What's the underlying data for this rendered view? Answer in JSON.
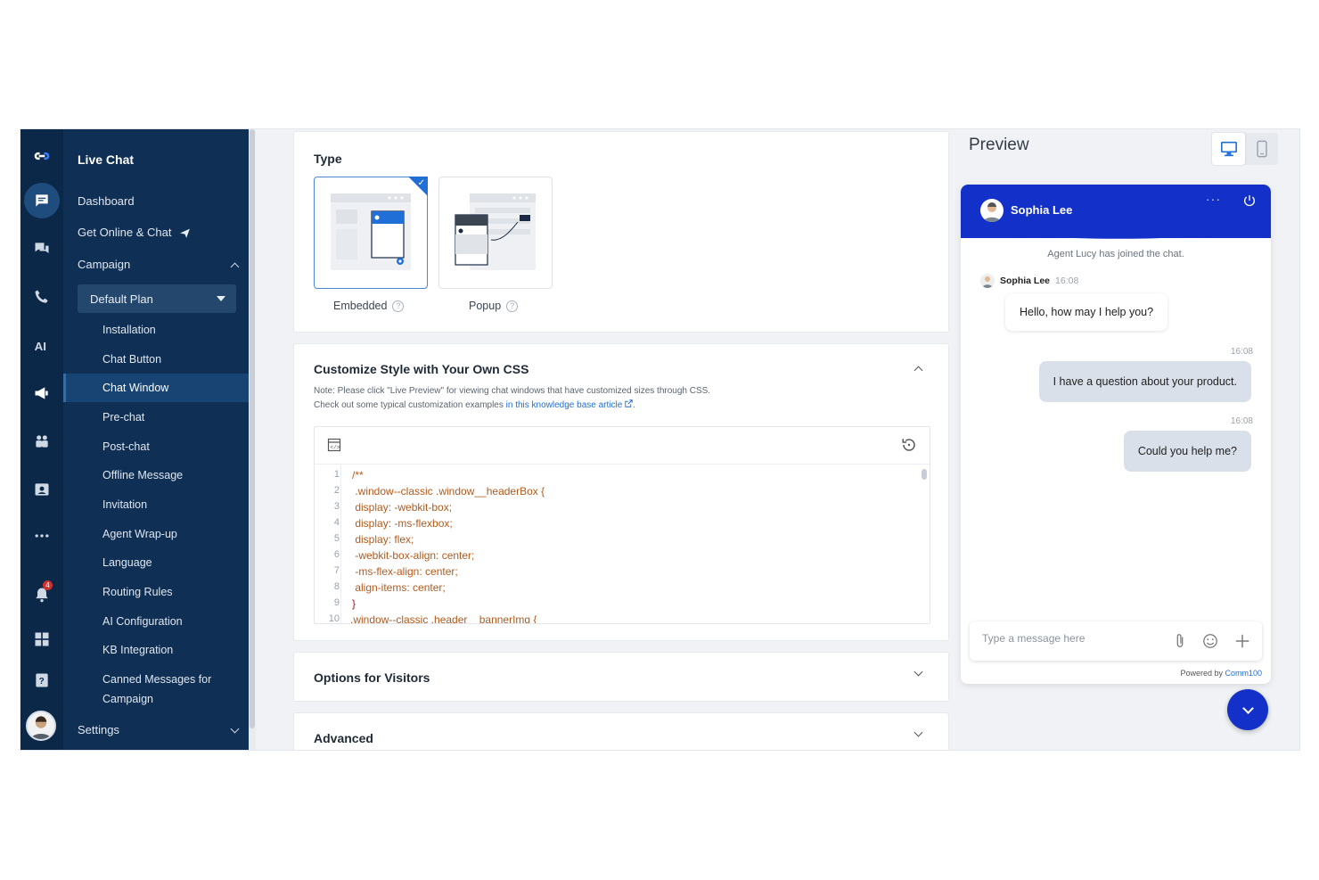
{
  "nav": {
    "title": "Live Chat",
    "items": {
      "dashboard": "Dashboard",
      "get_online": "Get Online & Chat",
      "campaign": "Campaign",
      "settings": "Settings"
    },
    "plan_select": "Default Plan",
    "sub_items": [
      "Installation",
      "Chat Button",
      "Chat Window",
      "Pre-chat",
      "Post-chat",
      "Offline Message",
      "Invitation",
      "Agent Wrap-up",
      "Language",
      "Routing Rules",
      "AI Configuration",
      "KB Integration",
      "Canned Messages for",
      "Campaign"
    ],
    "active_sub": "Chat Window",
    "notification_count": "4"
  },
  "type_section": {
    "title": "Type",
    "options": [
      {
        "label": "Embedded",
        "selected": true
      },
      {
        "label": "Popup",
        "selected": false
      }
    ],
    "help_glyph": "?"
  },
  "css_section": {
    "title": "Customize Style with Your Own CSS",
    "note_line1": "Note: Please click \"Live Preview\" for viewing chat windows that have customized sizes through CSS.",
    "note_line2_prefix": "Check out some typical customization examples ",
    "note_link": "in this knowledge base article",
    "note_line2_suffix": ".",
    "code_lines": [
      {
        "n": "1",
        "text": "/**"
      },
      {
        "n": "2",
        "text": " .window--classic .window__headerBox {"
      },
      {
        "n": "3",
        "text": " display: -webkit-box;"
      },
      {
        "n": "4",
        "text": " display: -ms-flexbox;"
      },
      {
        "n": "5",
        "text": " display: flex;"
      },
      {
        "n": "6",
        "text": " -webkit-box-align: center;"
      },
      {
        "n": "7",
        "text": " -ms-flex-align: center;"
      },
      {
        "n": "8",
        "text": " align-items: center;"
      },
      {
        "n": "9",
        "text": "}"
      },
      {
        "n": "10",
        "text": ".window--classic .header__bannerImg {"
      }
    ]
  },
  "options_section": {
    "title": "Options for Visitors"
  },
  "advanced_section": {
    "title": "Advanced"
  },
  "preview": {
    "title": "Preview",
    "agent_name": "Sophia Lee",
    "head_dots": "···",
    "system_message": "Agent Lucy has joined the chat.",
    "msg_name": "Sophia Lee",
    "msg_time": "16:08",
    "agent_message": "Hello, how may I help you?",
    "visitor_messages": [
      {
        "time": "16:08",
        "text": "I have a question about your product."
      },
      {
        "time": "16:08",
        "text": "Could you help me?"
      }
    ],
    "input_placeholder": "Type a message here",
    "powered_by": "Powered by ",
    "powered_brand": "Comm100"
  },
  "colors": {
    "rail": "#0c2848",
    "nav": "#0f2f55",
    "accent": "#1331c8",
    "link": "#1f6fd6"
  }
}
